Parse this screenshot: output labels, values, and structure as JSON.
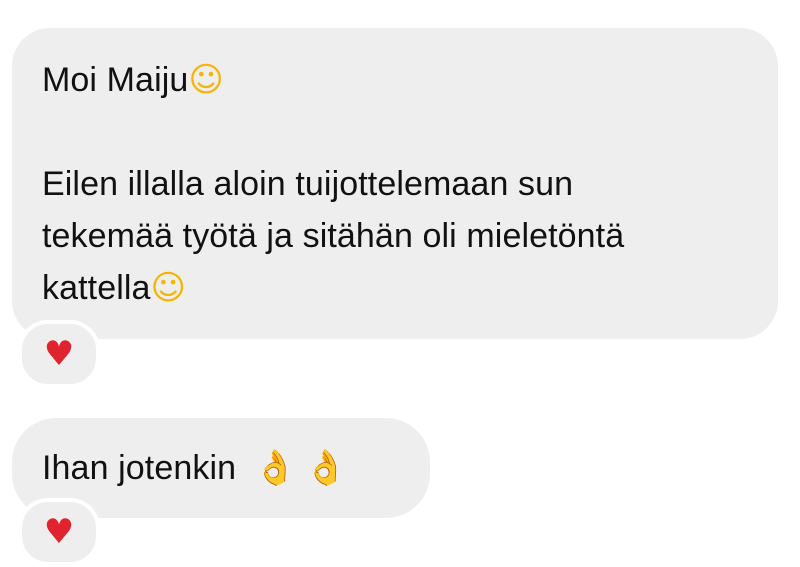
{
  "messages": [
    {
      "greeting": "Moi Maiju",
      "greeting_emoji": "☺",
      "body_lines": [
        "Eilen illalla aloin tuijottelemaan sun",
        "tekemää työtä ja sitähän oli mieletöntä",
        "kattella"
      ],
      "body_emoji": "☺",
      "reaction": "♥"
    },
    {
      "text": "Ihan jotenkin",
      "emojis": [
        "👌",
        "👌"
      ],
      "reaction": "♥"
    }
  ],
  "colors": {
    "bubble": "#eeeeef",
    "text": "#111111",
    "heart": "#e0242f",
    "background": "#ffffff"
  }
}
